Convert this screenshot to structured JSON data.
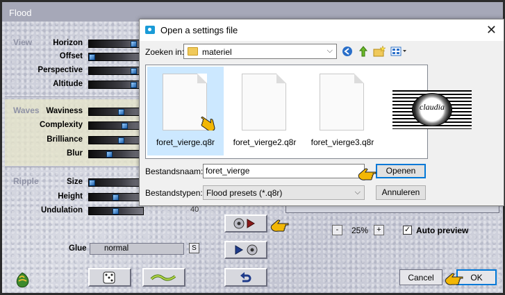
{
  "flood": {
    "title": "Flood",
    "sections": {
      "view": {
        "label": "View",
        "params": [
          {
            "label": "Horizon",
            "thumb": 0.9
          },
          {
            "label": "Offset",
            "thumb": 0.0
          },
          {
            "label": "Perspective",
            "thumb": 0.9
          },
          {
            "label": "Altitude",
            "thumb": 0.9
          }
        ]
      },
      "waves": {
        "label": "Waves",
        "params": [
          {
            "label": "Waviness",
            "thumb": 0.62
          },
          {
            "label": "Complexity",
            "thumb": 0.7
          },
          {
            "label": "Brilliance",
            "thumb": 0.62
          },
          {
            "label": "Blur",
            "thumb": 0.38
          }
        ]
      },
      "ripple": {
        "label": "Ripple",
        "params": [
          {
            "label": "Size",
            "thumb": 0.0
          },
          {
            "label": "Height",
            "thumb": 0.5
          },
          {
            "label": "Undulation",
            "thumb": 0.5
          }
        ]
      }
    },
    "undulation_value": "40",
    "glue_label": "Glue",
    "glue_value": "normal",
    "glue_s": "S",
    "zoom_minus": "-",
    "zoom_plus": "+",
    "zoom_value": "25%",
    "auto_preview_checked": "✓",
    "auto_preview_label": "Auto preview",
    "cancel_label": "Cancel",
    "ok_label": "OK"
  },
  "dialog": {
    "title": "Open a settings file",
    "close": "✕",
    "look_in_label": "Zoeken in:",
    "look_in_value": "materiel",
    "files": [
      {
        "name": "foret_vierge.q8r",
        "selected": true
      },
      {
        "name": "foret_vierge2.q8r",
        "selected": false
      },
      {
        "name": "foret_vierge3.q8r",
        "selected": false
      }
    ],
    "thumbnail_text": "claudia",
    "filename_label": "Bestandsnaam:",
    "filename_value": "foret_vierge",
    "filetype_label": "Bestandstypen:",
    "filetype_value": "Flood presets (*.q8r)",
    "open_label": "Openen",
    "cancel_label": "Annuleren"
  },
  "colors": {
    "dialog_accent": "#0078d7",
    "selection": "#cce8ff",
    "hand": "#f2b705"
  }
}
